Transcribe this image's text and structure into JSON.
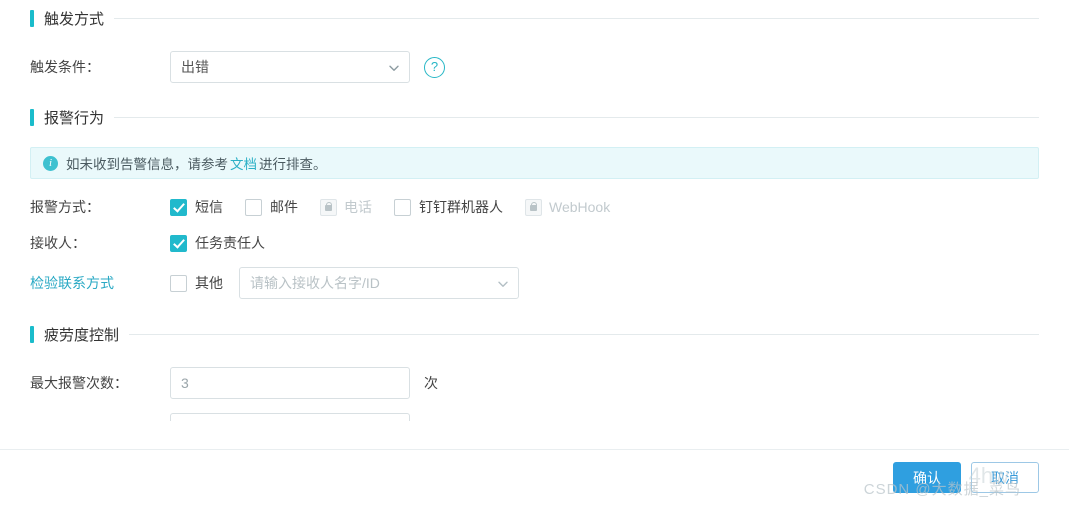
{
  "sections": {
    "trigger": {
      "title": "触发方式"
    },
    "alarm": {
      "title": "报警行为"
    },
    "fatigue": {
      "title": "疲劳度控制"
    }
  },
  "trigger_row": {
    "label": "触发条件：",
    "value": "出错",
    "help_icon": "question-circle-icon",
    "caret_icon": "chevron-down-icon"
  },
  "banner": {
    "icon": "info-icon",
    "text_before": "如未收到告警信息，请参考",
    "link": "文档",
    "text_after": "进行排查。"
  },
  "alarm_method": {
    "label": "报警方式：",
    "options": [
      {
        "label": "短信",
        "checked": true,
        "disabled": false
      },
      {
        "label": "邮件",
        "checked": false,
        "disabled": false
      },
      {
        "label": "电话",
        "checked": false,
        "disabled": true
      },
      {
        "label": "钉钉群机器人",
        "checked": false,
        "disabled": false
      },
      {
        "label": "WebHook",
        "checked": false,
        "disabled": true
      }
    ]
  },
  "receiver": {
    "label": "接收人：",
    "link": "检验联系方式",
    "owner": {
      "label": "任务责任人",
      "checked": true
    },
    "other": {
      "label": "其他",
      "checked": false
    },
    "input_placeholder": "请输入接收人名字/ID",
    "caret_icon": "chevron-down-icon"
  },
  "fatigue_row": {
    "label": "最大报警次数：",
    "value": "3",
    "unit": "次"
  },
  "footer": {
    "confirm": "确认",
    "cancel": "取消"
  },
  "watermark": {
    "text": "CSDN @大数据_菜鸟",
    "overlay": "4hw"
  }
}
